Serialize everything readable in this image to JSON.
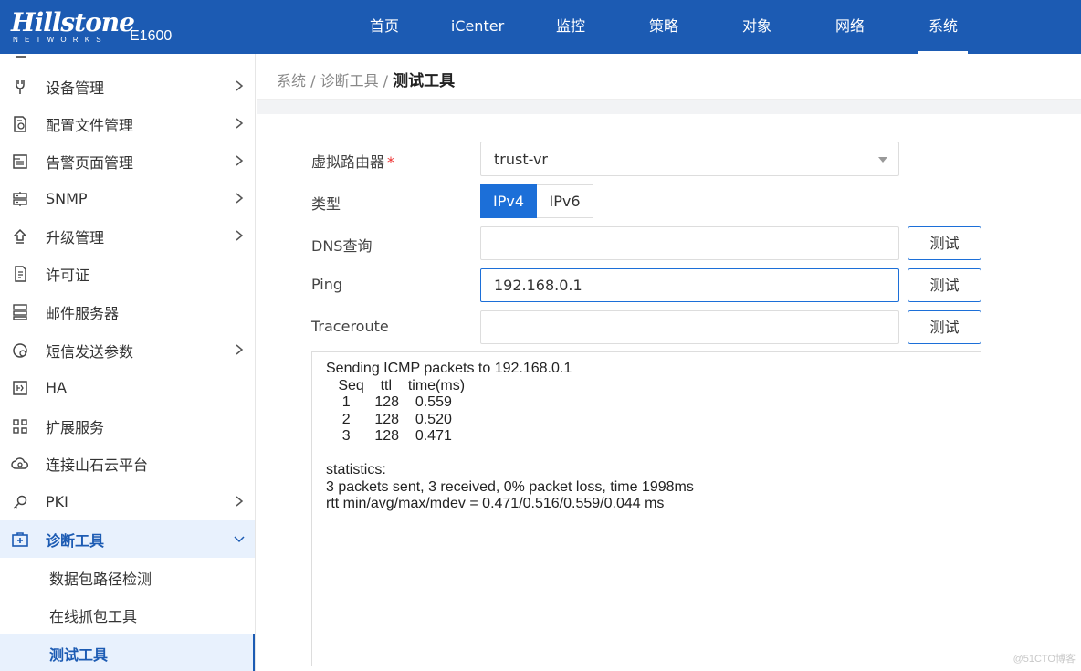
{
  "header": {
    "brand": "Hillstone",
    "brand_sub": "NETWORKS",
    "model": "E1600",
    "nav": [
      "首页",
      "iCenter",
      "监控",
      "策略",
      "对象",
      "网络",
      "系统"
    ],
    "active_nav": "系统"
  },
  "sidebar": {
    "items": [
      {
        "label": "设备管理",
        "icon": "wrench-icon",
        "has_arrow": true
      },
      {
        "label": "配置文件管理",
        "icon": "config-file-icon",
        "has_arrow": true
      },
      {
        "label": "告警页面管理",
        "icon": "alarm-page-icon",
        "has_arrow": true
      },
      {
        "label": "SNMP",
        "icon": "snmp-icon",
        "has_arrow": true
      },
      {
        "label": "升级管理",
        "icon": "upgrade-icon",
        "has_arrow": true
      },
      {
        "label": "许可证",
        "icon": "license-icon",
        "has_arrow": false
      },
      {
        "label": "邮件服务器",
        "icon": "mail-server-icon",
        "has_arrow": false
      },
      {
        "label": "短信发送参数",
        "icon": "sms-icon",
        "has_arrow": true
      },
      {
        "label": "HA",
        "icon": "ha-icon",
        "has_arrow": false
      },
      {
        "label": "扩展服务",
        "icon": "extension-icon",
        "has_arrow": false
      },
      {
        "label": "连接山石云平台",
        "icon": "cloud-icon",
        "has_arrow": false
      },
      {
        "label": "PKI",
        "icon": "key-icon",
        "has_arrow": true
      },
      {
        "label": "诊断工具",
        "icon": "medical-kit-icon",
        "has_arrow": true,
        "expanded": true
      }
    ],
    "sub_items": [
      {
        "label": "数据包路径检测"
      },
      {
        "label": "在线抓包工具"
      },
      {
        "label": "测试工具",
        "current": true
      }
    ]
  },
  "breadcrumb": {
    "path": "系统 / 诊断工具 / ",
    "current": "测试工具"
  },
  "form": {
    "vr_label": "虚拟路由器",
    "vr_required_mark": "*",
    "vr_value": "trust-vr",
    "type_label": "类型",
    "type_options": [
      "IPv4",
      "IPv6"
    ],
    "type_selected": "IPv4",
    "dns_label": "DNS查询",
    "dns_value": "",
    "ping_label": "Ping",
    "ping_value": "192.168.0.1",
    "traceroute_label": "Traceroute",
    "traceroute_value": "",
    "test_button": "测试"
  },
  "output": {
    "lines": [
      "Sending ICMP packets to 192.168.0.1",
      "   Seq    ttl    time(ms)",
      "    1      128    0.559",
      "    2      128    0.520",
      "    3      128    0.471",
      "",
      "statistics:",
      "3 packets sent, 3 received, 0% packet loss, time 1998ms",
      "rtt min/avg/max/mdev = 0.471/0.516/0.559/0.044 ms"
    ]
  },
  "watermark": "@51CTO博客",
  "colors": {
    "header_bg": "#1c5bb3",
    "accent": "#1c6fd8",
    "required": "#e33333"
  }
}
